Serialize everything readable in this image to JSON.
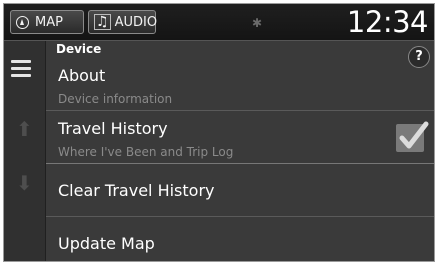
{
  "topbar": {
    "map_label": "MAP",
    "audio_label": "AUDIO",
    "bluetooth_icon": "ʙ",
    "clock": "12:34"
  },
  "section": {
    "title": "Device",
    "help_label": "?"
  },
  "menu": {
    "items": [
      {
        "label": "About",
        "sublabel": "Device information"
      },
      {
        "label": "Travel History",
        "sublabel": "Where I've Been and Trip Log",
        "checked": true
      },
      {
        "label": "Clear Travel History"
      },
      {
        "label": "Update Map"
      }
    ]
  },
  "colors": {
    "background": "#3a3a3a",
    "topbar": "#1a1a1a",
    "text": "#ffffff",
    "subtext": "#8a8a8a",
    "checkbox": "#7a7a7a"
  }
}
